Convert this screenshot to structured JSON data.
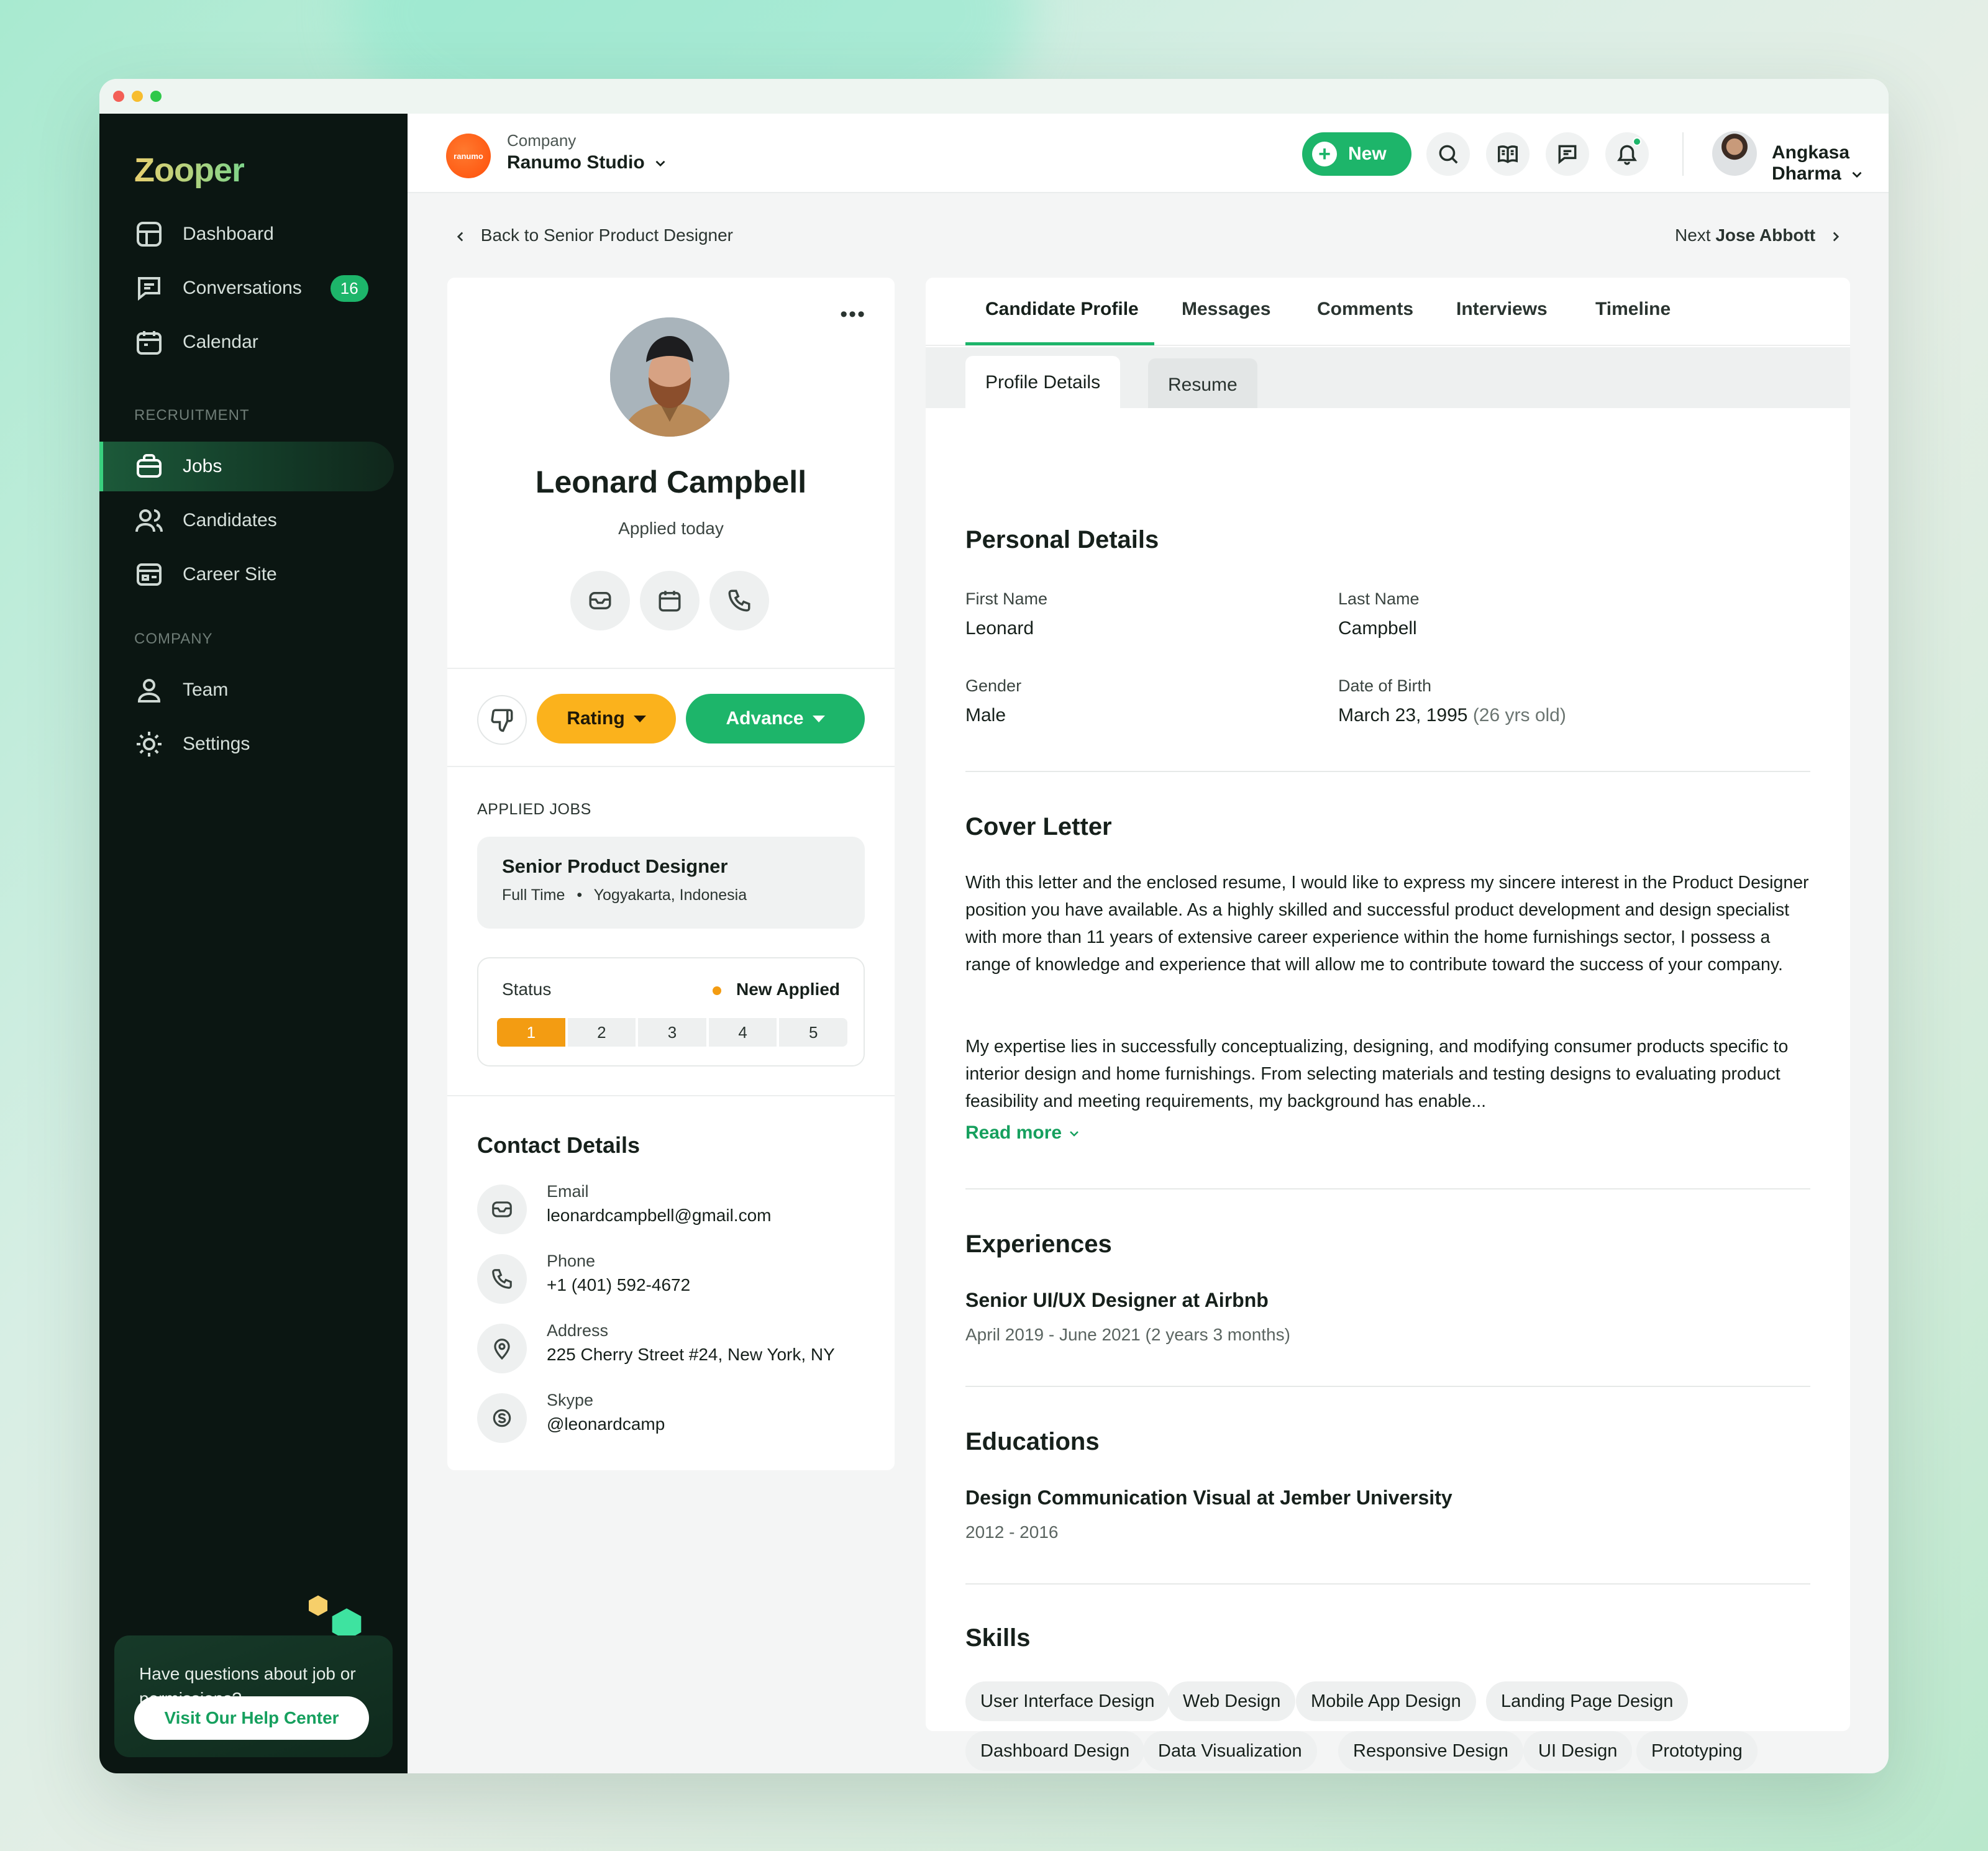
{
  "app": {
    "name": "Zooper"
  },
  "sidebar": {
    "items_main": [
      {
        "label": "Dashboard",
        "icon": "dashboard-icon"
      },
      {
        "label": "Conversations",
        "icon": "chat-icon",
        "badge": "16"
      },
      {
        "label": "Calendar",
        "icon": "calendar-icon"
      }
    ],
    "recruitment_title": "RECRUITMENT",
    "items_recruitment": [
      {
        "label": "Jobs",
        "icon": "briefcase-icon",
        "active": true
      },
      {
        "label": "Candidates",
        "icon": "users-icon"
      },
      {
        "label": "Career Site",
        "icon": "browser-icon"
      }
    ],
    "company_title": "COMPANY",
    "items_company": [
      {
        "label": "Team",
        "icon": "user-icon"
      },
      {
        "label": "Settings",
        "icon": "gear-icon"
      }
    ],
    "help": {
      "text": "Have questions about job or permissions?",
      "button": "Visit Our Help Center"
    }
  },
  "topbar": {
    "company_label": "Company",
    "company_name": "Ranumo Studio",
    "company_logo_text": "ranumo",
    "new_button": "New",
    "user_name": "Angkasa Dharma"
  },
  "breadcrumb": {
    "back": "Back to Senior Product Designer",
    "next_prefix": "Next",
    "next_name": "Jose Abbott"
  },
  "candidate": {
    "name": "Leonard Campbell",
    "applied": "Applied today",
    "rating_label": "Rating",
    "advance_label": "Advance",
    "applied_jobs_title": "APPLIED JOBS",
    "job_title": "Senior Product Designer",
    "job_type": "Full Time",
    "job_location": "Yogyakarta, Indonesia",
    "status_label": "Status",
    "status_value": "New Applied",
    "steps": [
      "1",
      "2",
      "3",
      "4",
      "5"
    ],
    "current_step": 1
  },
  "contact": {
    "title": "Contact Details",
    "rows": [
      {
        "label": "Email",
        "value": "leonardcampbell@gmail.com",
        "icon": "mail-icon"
      },
      {
        "label": "Phone",
        "value": "+1 (401) 592-4672",
        "icon": "phone-icon"
      },
      {
        "label": "Address",
        "value": "225 Cherry Street #24, New York, NY",
        "icon": "location-icon"
      },
      {
        "label": "Skype",
        "value": "@leonardcamp",
        "icon": "skype-icon"
      }
    ]
  },
  "tabs": [
    "Candidate Profile",
    "Messages",
    "Comments",
    "Interviews",
    "Timeline"
  ],
  "subtabs": [
    "Profile Details",
    "Resume"
  ],
  "personal": {
    "title": "Personal Details",
    "first_name_label": "First Name",
    "first_name": "Leonard",
    "last_name_label": "Last Name",
    "last_name": "Campbell",
    "gender_label": "Gender",
    "gender": "Male",
    "dob_label": "Date of Birth",
    "dob": "March 23, 1995",
    "age": "(26 yrs old)"
  },
  "cover": {
    "title": "Cover Letter",
    "p1": "With this letter and the enclosed resume, I would like to express my sincere interest in the Product Designer position you have available. As a highly skilled and successful product development and design specialist with more than 11 years of extensive career experience within the home furnishings sector, I possess a range of knowledge and experience that will allow me to contribute toward the success of your company.",
    "p2": "My expertise lies in successfully conceptualizing, designing, and modifying consumer products specific to interior design and home furnishings. From selecting materials and testing designs to evaluating product feasibility and meeting requirements, my background has enable...",
    "read_more": "Read more"
  },
  "experiences": {
    "title": "Experiences",
    "role": "Senior UI/UX Designer at Airbnb",
    "period": "April 2019 - June 2021 (2 years 3 months)"
  },
  "educations": {
    "title": "Educations",
    "program": "Design Communication Visual at Jember University",
    "period": "2012 - 2016"
  },
  "skills": {
    "title": "Skills",
    "row1": [
      "User Interface Design",
      "Web Design",
      "Mobile App Design",
      "Landing Page Design"
    ],
    "row2": [
      "Dashboard Design",
      "Data Visualization",
      "Responsive Design",
      "UI Design",
      "Prototyping"
    ]
  },
  "colors": {
    "accent": "#1db56a",
    "rating": "#fbb21c",
    "sidebar": "#0b1612",
    "step_active": "#f39c12"
  }
}
